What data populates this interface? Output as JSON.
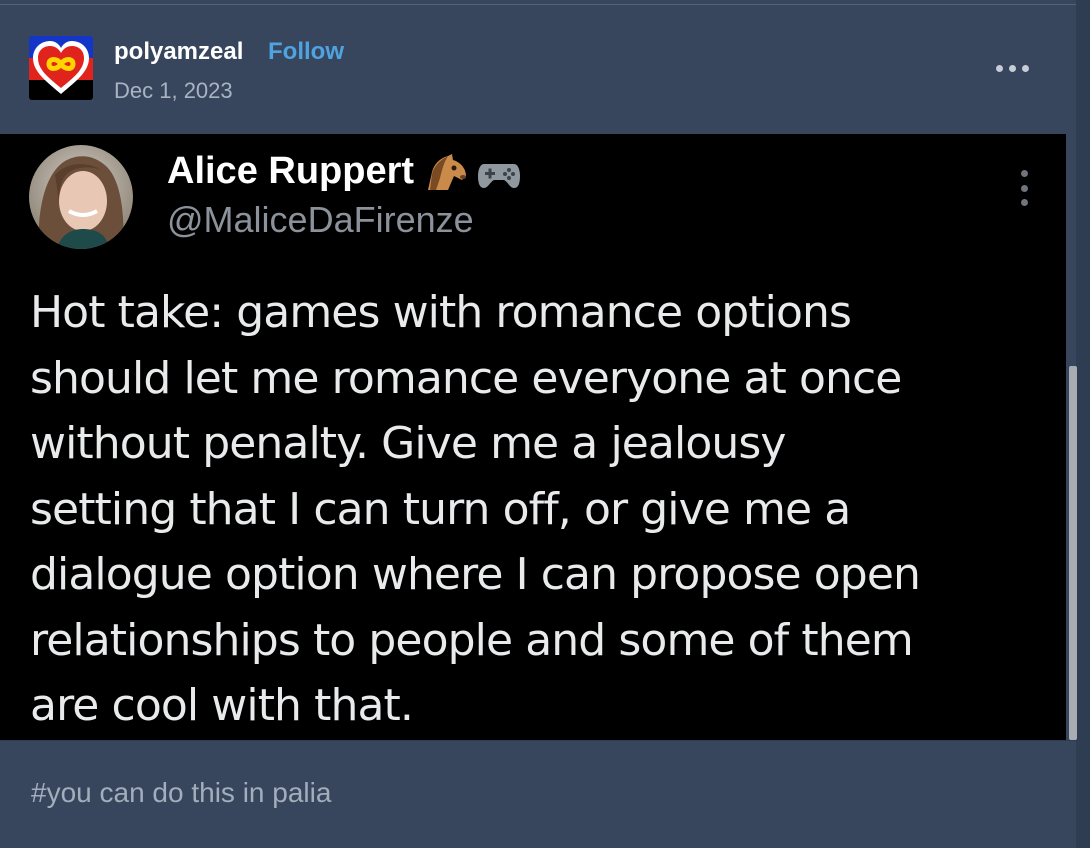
{
  "post": {
    "username": "polyamzeal",
    "follow_label": "Follow",
    "date": "Dec 1, 2023",
    "avatar_icon": "polyamory-heart-infinity-icon",
    "more_icon": "more-options-icon"
  },
  "tweet": {
    "display_name": "Alice Ruppert",
    "name_emojis": [
      "horse-face-icon",
      "game-controller-icon"
    ],
    "handle": "@MaliceDaFirenze",
    "text_lines": [
      "Hot take: games with romance options",
      "should let me romance everyone at once",
      "without penalty. Give me a jealousy",
      "setting that I can turn off, or give me a",
      "dialogue option where I can propose open",
      "relationships to people and some of them",
      "are cool with that."
    ]
  },
  "tags": [
    "#you can do this in palia"
  ],
  "colors": {
    "background": "#37465c",
    "accent_link": "#4fa3e0",
    "tweet_background": "#000000"
  }
}
